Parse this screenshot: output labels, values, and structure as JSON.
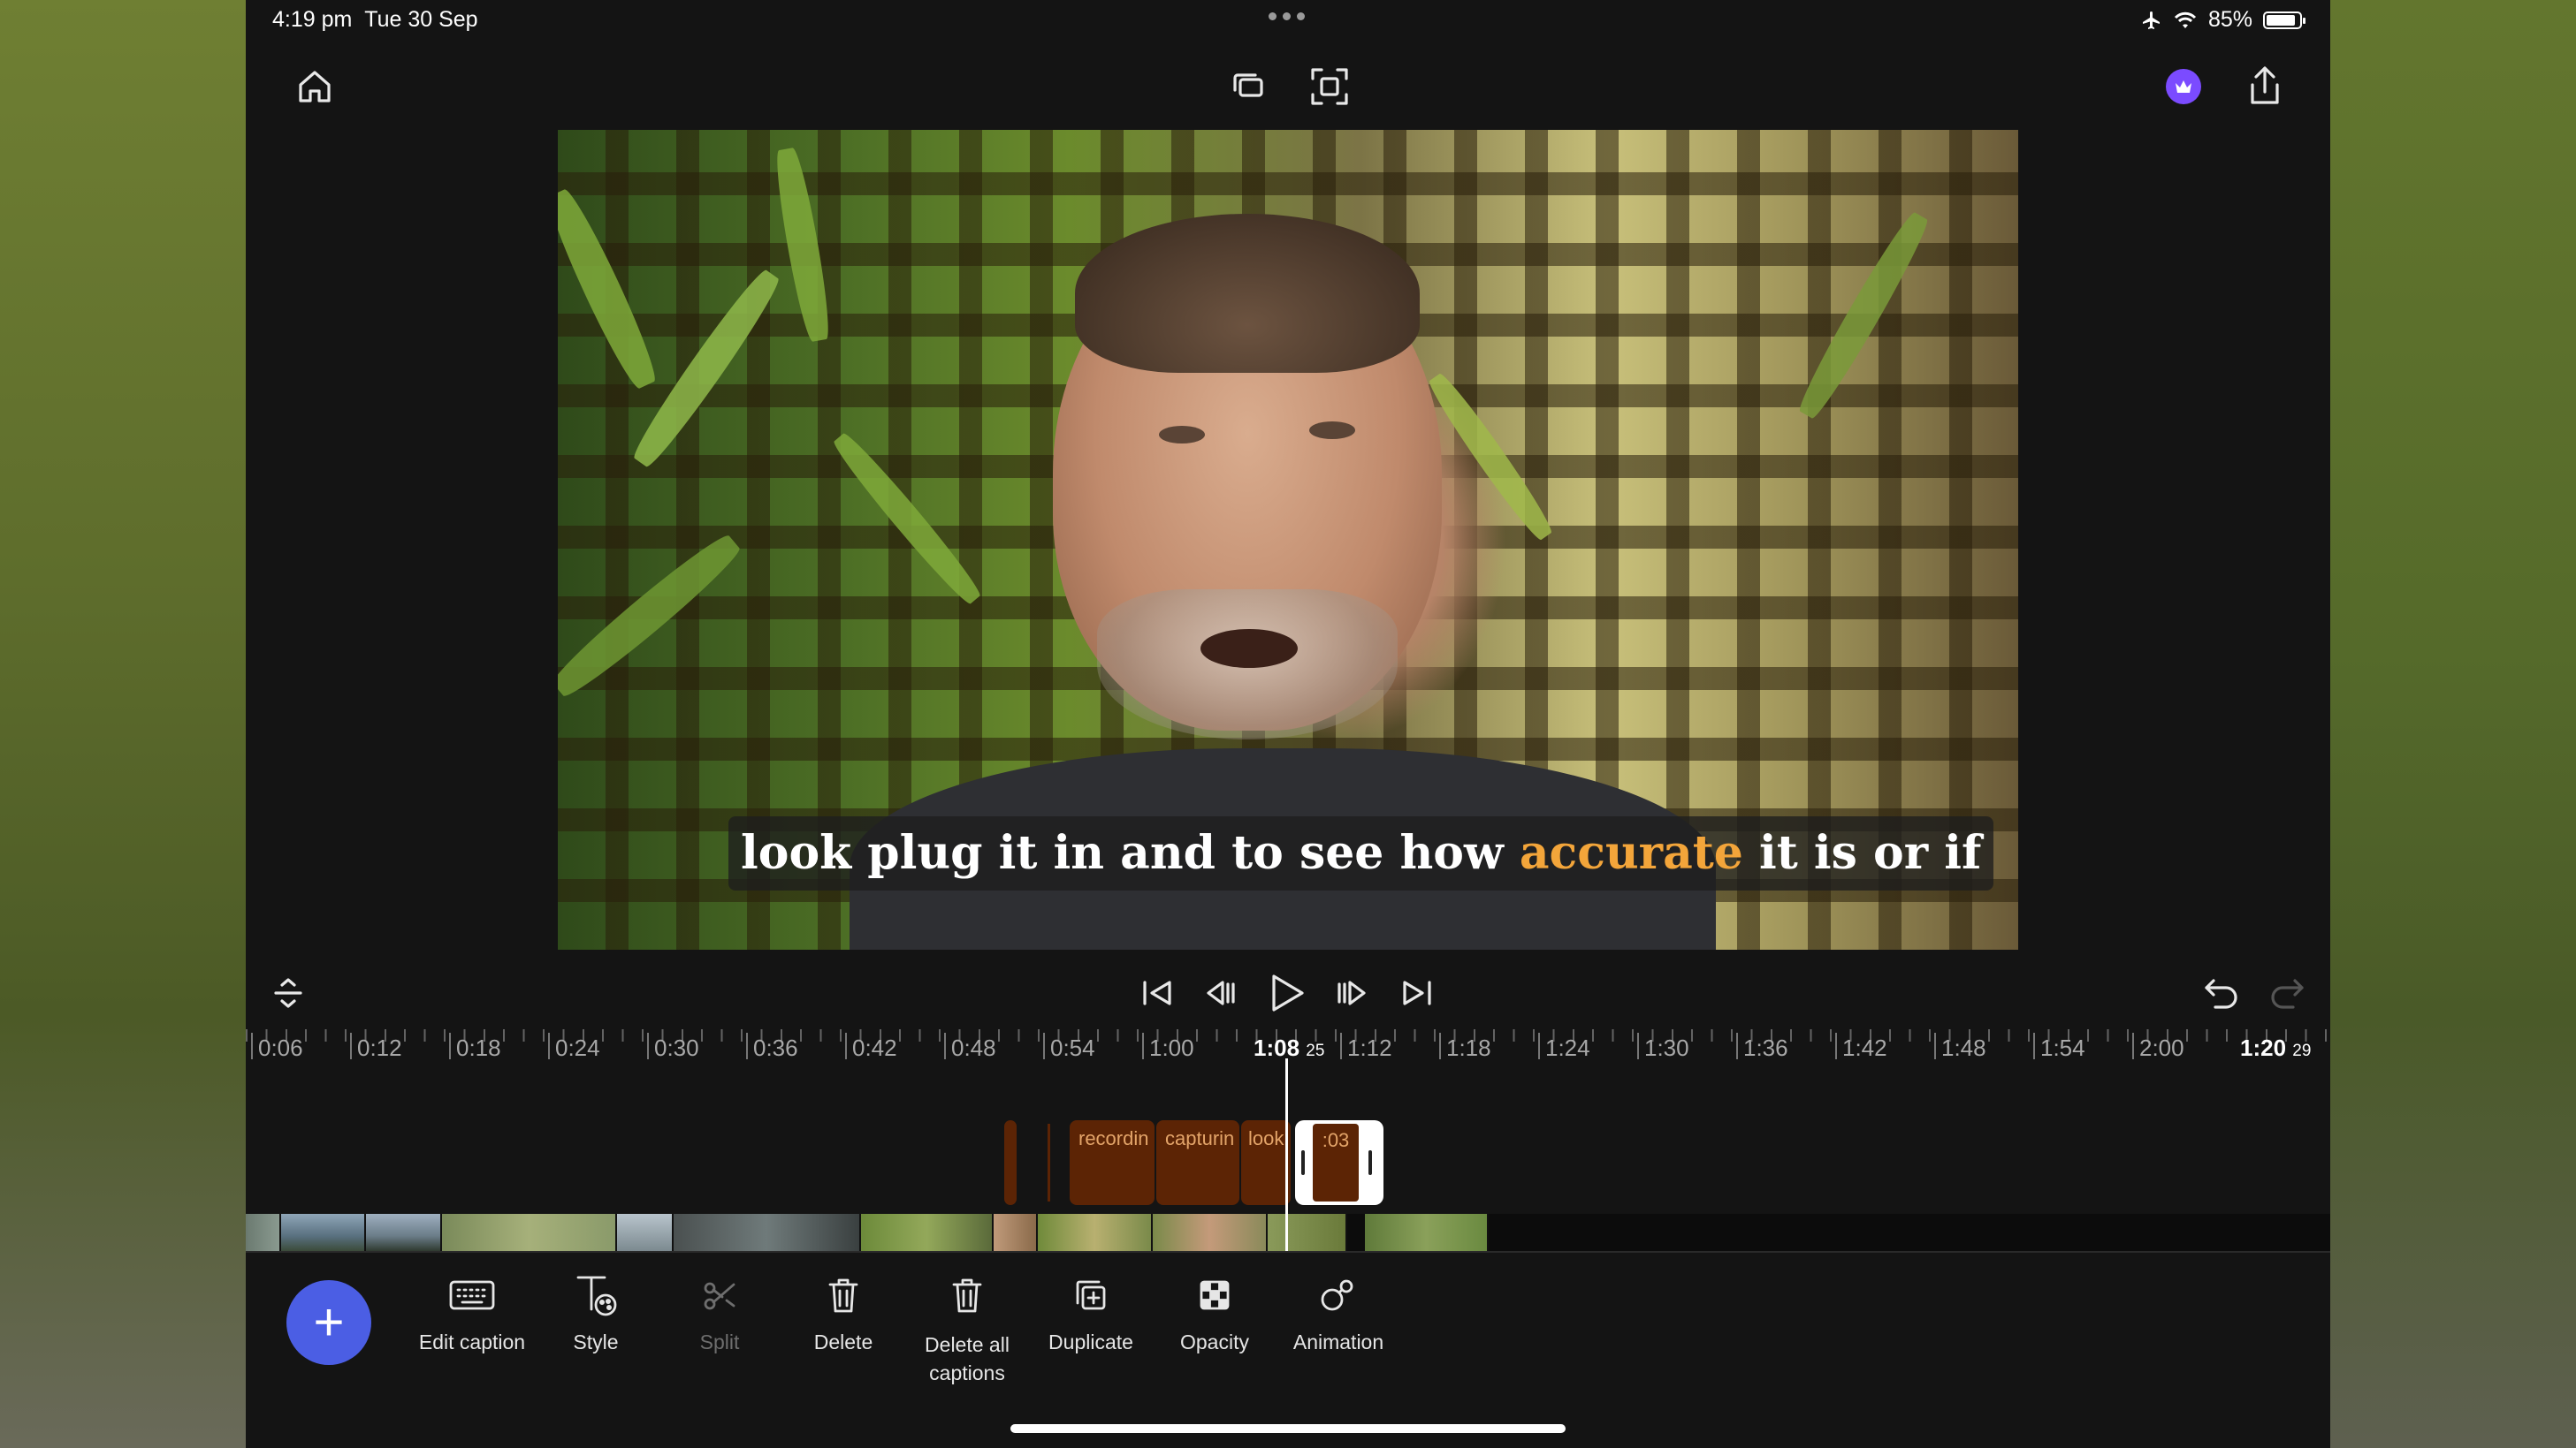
{
  "status_bar": {
    "time": "4:19 pm",
    "date": "Tue 30 Sep",
    "battery": "85%"
  },
  "top_bar": {
    "home_icon": "home-icon",
    "aspect_icon": "aspect-ratio-icon",
    "fullscreen_icon": "fullscreen-icon",
    "premium_icon": "crown-icon",
    "share_icon": "share-icon",
    "premium_color": "#7b4bff"
  },
  "preview": {
    "caption_before": "look plug it in and to see how ",
    "caption_highlight": "accurate",
    "caption_after": " it is or if",
    "highlight_color": "#f3a53a"
  },
  "timeline": {
    "labels": [
      "0:06",
      "0:12",
      "0:18",
      "0:24",
      "0:30",
      "0:36",
      "0:42",
      "0:48",
      "0:54",
      "1:00",
      "1:12",
      "1:18",
      "1:24",
      "1:30",
      "1:36",
      "1:42",
      "1:48",
      "1:54",
      "2:00"
    ],
    "current_time": "1:08",
    "current_frame": "25",
    "end_time": "1:20",
    "end_frame": "29",
    "caption_clips": [
      "recordin",
      "capturin",
      "look"
    ],
    "selected_clip_label": ":03"
  },
  "toolbar": {
    "add_label": "+",
    "tools": [
      {
        "label": "Edit caption",
        "icon": "keyboard-icon",
        "enabled": true
      },
      {
        "label": "Style",
        "icon": "text-style-icon",
        "enabled": true
      },
      {
        "label": "Split",
        "icon": "scissors-icon",
        "enabled": false
      },
      {
        "label": "Delete",
        "icon": "trash-icon",
        "enabled": true
      },
      {
        "label": "Delete all captions",
        "icon": "trash-all-icon",
        "enabled": true
      },
      {
        "label": "Duplicate",
        "icon": "duplicate-icon",
        "enabled": true
      },
      {
        "label": "Opacity",
        "icon": "opacity-icon",
        "enabled": true
      },
      {
        "label": "Animation",
        "icon": "animation-icon",
        "enabled": true
      }
    ]
  }
}
